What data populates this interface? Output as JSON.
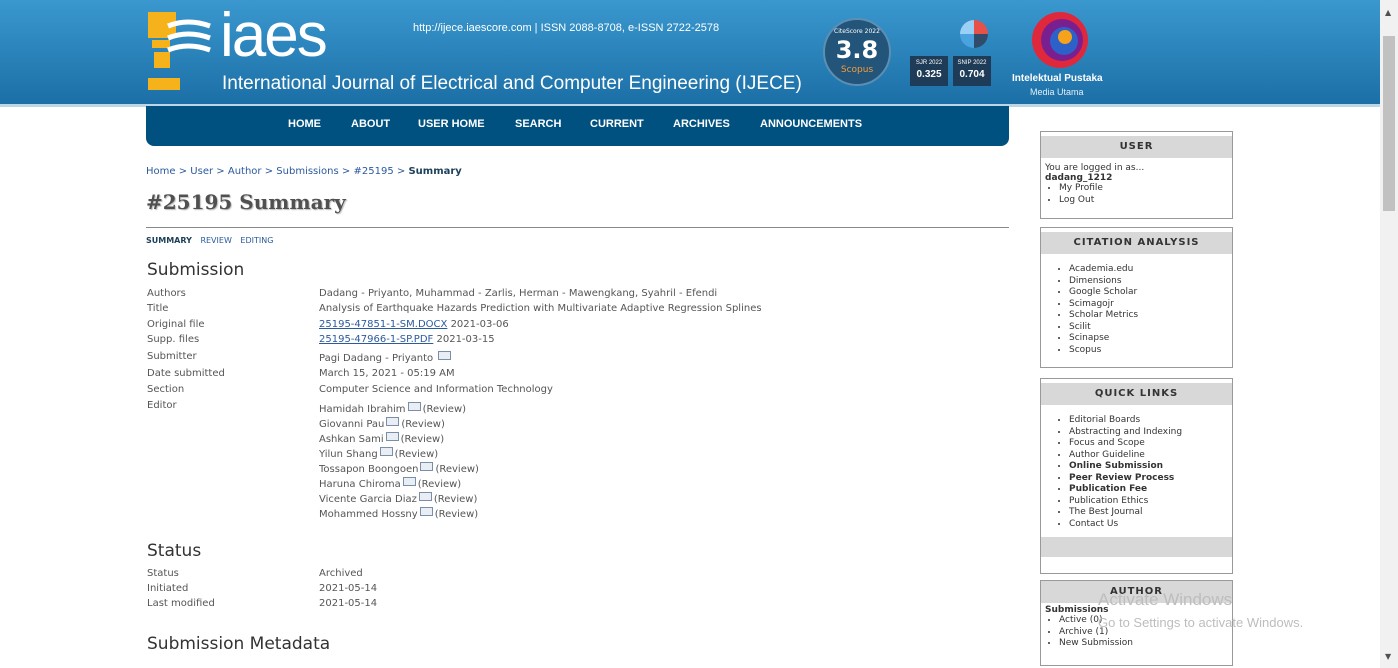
{
  "header": {
    "logo_text": "iaes",
    "journal_title": "International Journal of Electrical and Computer Engineering (IJECE)",
    "issn_line": "http://ijece.iaescore.com  |  ISSN 2088-8708, e-ISSN 2722-2578",
    "citescore": {
      "label": "CiteScore 2022",
      "value": "3.8",
      "source": "Scopus"
    },
    "sjr": {
      "label": "SJR 2022",
      "value": "0.325"
    },
    "snip": {
      "label": "SNIP 2022",
      "value": "0.704"
    },
    "publisher_name": "Intelektual Pustaka",
    "publisher_sub": "Media Utama"
  },
  "nav": [
    "HOME",
    "ABOUT",
    "USER HOME",
    "SEARCH",
    "CURRENT",
    "ARCHIVES",
    "ANNOUNCEMENTS"
  ],
  "breadcrumb": {
    "home": "Home",
    "user": "User",
    "author": "Author",
    "submissions": "Submissions",
    "id": "#25195",
    "current": "Summary",
    "sep": ">"
  },
  "page_title": "#25195 Summary",
  "subtabs": {
    "summary": "SUMMARY",
    "review": "REVIEW",
    "editing": "EDITING"
  },
  "submission": {
    "heading": "Submission",
    "labels": {
      "authors": "Authors",
      "title": "Title",
      "original_file": "Original file",
      "supp_files": "Supp. files",
      "submitter": "Submitter",
      "date_submitted": "Date submitted",
      "section": "Section",
      "editor": "Editor"
    },
    "authors": "Dadang - Priyanto, Muhammad - Zarlis, Herman - Mawengkang, Syahril - Efendi",
    "title": "Analysis of Earthquake Hazards Prediction with Multivariate Adaptive Regression Splines",
    "original_file": {
      "name": "25195-47851-1-SM.DOCX",
      "date": "2021-03-06"
    },
    "supp_file": {
      "name": "25195-47966-1-SP.PDF",
      "date": "2021-03-15"
    },
    "submitter": "Pagi Dadang - Priyanto",
    "date_submitted": "March 15, 2021 - 05:19 AM",
    "section": "Computer Science and Information Technology",
    "review_label": "(Review)",
    "editors": [
      "Hamidah Ibrahim",
      "Giovanni Pau",
      "Ashkan Sami",
      "Yilun Shang",
      "Tossapon Boongoen",
      "Haruna Chiroma",
      "Vicente Garcia Diaz",
      "Mohammed Hossny"
    ]
  },
  "status": {
    "heading": "Status",
    "labels": {
      "status": "Status",
      "initiated": "Initiated",
      "last_modified": "Last modified"
    },
    "status": "Archived",
    "initiated": "2021-05-14",
    "last_modified": "2021-05-14"
  },
  "metadata_heading": "Submission Metadata",
  "sidebar": {
    "user": {
      "title": "USER",
      "logged_in": "You are logged in as...",
      "username": "dadang_1212",
      "links": [
        "My Profile",
        "Log Out"
      ]
    },
    "citation": {
      "title": "CITATION ANALYSIS",
      "links": [
        "Academia.edu",
        "Dimensions",
        "Google Scholar",
        "Scimagojr",
        "Scholar Metrics",
        "Scilit",
        "Scinapse",
        "Scopus"
      ]
    },
    "quick": {
      "title": "QUICK LINKS",
      "links": [
        "Editorial Boards",
        "Abstracting and Indexing",
        "Focus and Scope",
        "Author Guideline",
        "Online Submission",
        "Peer Review Process",
        "Publication Fee",
        "Publication Ethics",
        "The Best Journal",
        "Contact Us"
      ]
    },
    "author": {
      "title": "AUTHOR",
      "submissions": "Submissions",
      "links": [
        "Active (0)",
        "Archive (1)",
        "New Submission"
      ]
    }
  },
  "watermark": {
    "line1": "Activate Windows",
    "line2": "Go to Settings to activate Windows."
  },
  "colors": {
    "banner": "#2d86c0",
    "navbar": "#005180",
    "link": "#2b5a9e"
  }
}
